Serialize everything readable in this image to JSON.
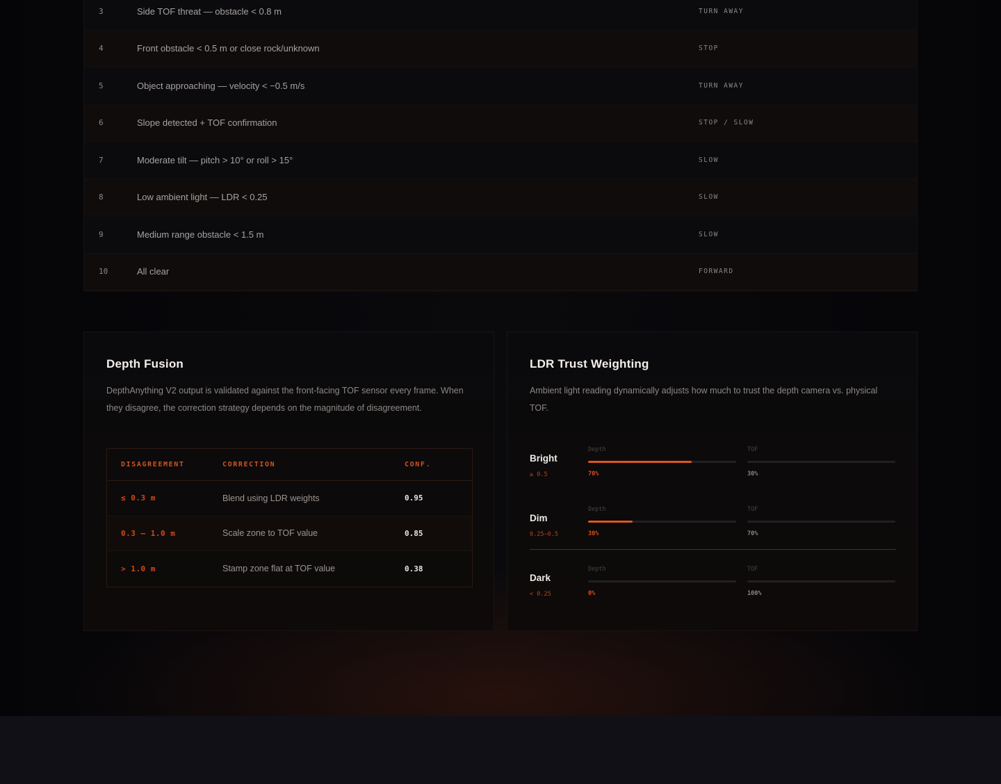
{
  "priority_rows": [
    {
      "num": "3",
      "condition": "Side TOF threat — obstacle < 0.8 m",
      "action": "TURN AWAY"
    },
    {
      "num": "4",
      "condition": "Front obstacle < 0.5 m or close rock/unknown",
      "action": "STOP"
    },
    {
      "num": "5",
      "condition": "Object approaching — velocity < −0.5 m/s",
      "action": "TURN AWAY"
    },
    {
      "num": "6",
      "condition": "Slope detected + TOF confirmation",
      "action": "STOP / SLOW"
    },
    {
      "num": "7",
      "condition": "Moderate tilt — pitch > 10° or roll > 15°",
      "action": "SLOW"
    },
    {
      "num": "8",
      "condition": "Low ambient light — LDR < 0.25",
      "action": "SLOW"
    },
    {
      "num": "9",
      "condition": "Medium range obstacle < 1.5 m",
      "action": "SLOW"
    },
    {
      "num": "10",
      "condition": "All clear",
      "action": "FORWARD"
    }
  ],
  "depth_fusion": {
    "title": "Depth Fusion",
    "description": "DepthAnything V2 output is validated against the front-facing TOF sensor every frame. When they disagree, the correction strategy depends on the magnitude of disagreement.",
    "headers": {
      "disagreement": "DISAGREEMENT",
      "correction": "CORRECTION",
      "confidence": "CONF."
    },
    "rows": [
      {
        "disagreement": "≤ 0.3 m",
        "correction": "Blend using LDR weights",
        "confidence": "0.95"
      },
      {
        "disagreement": "0.3 – 1.0 m",
        "correction": "Scale zone to TOF value",
        "confidence": "0.85"
      },
      {
        "disagreement": "> 1.0 m",
        "correction": "Stamp zone flat at TOF value",
        "confidence": "0.38"
      }
    ]
  },
  "ldr_weighting": {
    "title": "LDR Trust Weighting",
    "description": "Ambient light reading dynamically adjusts how much to trust the depth camera vs. physical TOF.",
    "depth_caption": "Depth",
    "tof_caption": "TOF",
    "levels": [
      {
        "label": "Bright",
        "range": "≥ 0.5",
        "depth_pct_label": "70%",
        "depth_fraction": 0.7,
        "tof_pct_label": "30%",
        "tof_fraction": 0.3
      },
      {
        "label": "Dim",
        "range": "0.25–0.5",
        "depth_pct_label": "30%",
        "depth_fraction": 0.3,
        "tof_pct_label": "70%",
        "tof_fraction": 0.7
      },
      {
        "label": "Dark",
        "range": "< 0.25",
        "depth_pct_label": "0%",
        "depth_fraction": 0.0,
        "tof_pct_label": "100%",
        "tof_fraction": 1.0
      }
    ]
  },
  "colors": {
    "accent": "#e0551e",
    "background": "#07070a",
    "footer": "#111017"
  }
}
